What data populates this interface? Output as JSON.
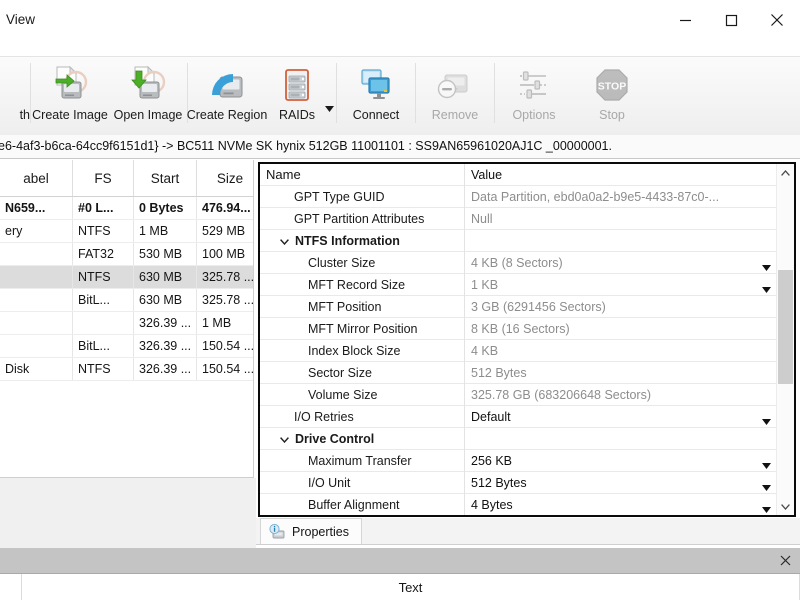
{
  "window": {
    "menu": [
      "View"
    ],
    "controls": {
      "minimize": "minimize-icon",
      "maximize": "maximize-icon",
      "close": "close-icon"
    }
  },
  "toolbar": {
    "clipped_label": "th",
    "buttons": [
      {
        "label": "Create Image",
        "icon": "create-image-icon",
        "enabled": true
      },
      {
        "label": "Open Image",
        "icon": "open-image-icon",
        "enabled": true
      },
      {
        "label": "Create Region",
        "icon": "create-region-icon",
        "enabled": true
      },
      {
        "label": "RAIDs",
        "icon": "raids-icon",
        "enabled": true,
        "has_dropdown": true
      },
      {
        "label": "Connect",
        "icon": "connect-icon",
        "enabled": true
      },
      {
        "label": "Remove",
        "icon": "remove-icon",
        "enabled": false
      },
      {
        "label": "Options",
        "icon": "options-icon",
        "enabled": false
      },
      {
        "label": "Stop",
        "icon": "stop-icon",
        "enabled": false
      }
    ]
  },
  "address_bar": {
    "text": "e6-4af3-b6ca-64cc9f6151d1} -> BC511 NVMe SK hynix 512GB 11001101 : SS9AN65961020AJ1C _00000001."
  },
  "partition_table": {
    "columns": [
      "abel",
      "FS",
      "Start",
      "Size"
    ],
    "rows": [
      {
        "label": "N659...",
        "fs": "#0 L...",
        "start": "0 Bytes",
        "size": "476.94...",
        "bold": true,
        "selected": false
      },
      {
        "label": "ery",
        "fs": "NTFS",
        "start": "1 MB",
        "size": "529 MB",
        "bold": false,
        "selected": false
      },
      {
        "label": "",
        "fs": "FAT32",
        "start": "530 MB",
        "size": "100 MB",
        "bold": false,
        "selected": false
      },
      {
        "label": "",
        "fs": "NTFS",
        "start": "630 MB",
        "size": "325.78 ...",
        "bold": false,
        "selected": true
      },
      {
        "label": "",
        "fs": "BitL...",
        "start": "630 MB",
        "size": "325.78 ...",
        "bold": false,
        "selected": false
      },
      {
        "label": "",
        "fs": "",
        "start": "326.39 ...",
        "size": "1 MB",
        "bold": false,
        "selected": false
      },
      {
        "label": "",
        "fs": "BitL...",
        "start": "326.39 ...",
        "size": "150.54 ...",
        "bold": false,
        "selected": false
      },
      {
        "label": "Disk",
        "fs": "NTFS",
        "start": "326.39 ...",
        "size": "150.54 ...",
        "bold": false,
        "selected": false
      }
    ]
  },
  "properties": {
    "columns": {
      "name": "Name",
      "value": "Value"
    },
    "rows": [
      {
        "name": "GPT Type GUID",
        "value": "Data Partition, ebd0a0a2-b9e5-4433-87c0-...",
        "indent": 2,
        "group": false,
        "muted": true,
        "dropdown": false
      },
      {
        "name": "GPT Partition Attributes",
        "value": "Null",
        "indent": 2,
        "group": false,
        "muted": true,
        "dropdown": false
      },
      {
        "name": "NTFS Information",
        "value": "",
        "indent": 1,
        "group": true,
        "muted": false,
        "dropdown": false,
        "chevron": "chevron-down-icon"
      },
      {
        "name": "Cluster Size",
        "value": "4 KB (8 Sectors)",
        "indent": 3,
        "group": false,
        "muted": true,
        "dropdown": true
      },
      {
        "name": "MFT Record Size",
        "value": "1 KB",
        "indent": 3,
        "group": false,
        "muted": true,
        "dropdown": true
      },
      {
        "name": "MFT Position",
        "value": "3 GB (6291456 Sectors)",
        "indent": 3,
        "group": false,
        "muted": true,
        "dropdown": false
      },
      {
        "name": "MFT Mirror Position",
        "value": "8 KB (16 Sectors)",
        "indent": 3,
        "group": false,
        "muted": true,
        "dropdown": false
      },
      {
        "name": "Index Block Size",
        "value": "4 KB",
        "indent": 3,
        "group": false,
        "muted": true,
        "dropdown": false
      },
      {
        "name": "Sector Size",
        "value": "512 Bytes",
        "indent": 3,
        "group": false,
        "muted": true,
        "dropdown": false
      },
      {
        "name": "Volume Size",
        "value": "325.78 GB (683206648 Sectors)",
        "indent": 3,
        "group": false,
        "muted": true,
        "dropdown": false
      },
      {
        "name": "I/O Retries",
        "value": "Default",
        "indent": 2,
        "group": false,
        "muted": false,
        "dropdown": true
      },
      {
        "name": "Drive Control",
        "value": "",
        "indent": 1,
        "group": true,
        "muted": false,
        "dropdown": false,
        "chevron": "chevron-down-icon"
      },
      {
        "name": "Maximum Transfer",
        "value": "256 KB",
        "indent": 3,
        "group": false,
        "muted": false,
        "dropdown": true
      },
      {
        "name": "I/O Unit",
        "value": "512 Bytes",
        "indent": 3,
        "group": false,
        "muted": false,
        "dropdown": true
      },
      {
        "name": "Buffer Alignment",
        "value": "4 Bytes",
        "indent": 3,
        "group": false,
        "muted": false,
        "dropdown": true
      }
    ]
  },
  "tabs": [
    {
      "label": "Properties",
      "icon": "properties-info-icon",
      "active": true
    }
  ],
  "bottom_panel": {
    "close": "close-icon",
    "column_header": "Text"
  },
  "colors": {
    "accent_blue": "#3b9fd8",
    "selection_grey": "#dcdcdc",
    "muted_text": "#8d8d8d",
    "panel_border": "#0a0a0a",
    "caption_bg": "#c4c4c4",
    "green_arrow": "#4caf27",
    "raid_orange": "#d4603a"
  }
}
